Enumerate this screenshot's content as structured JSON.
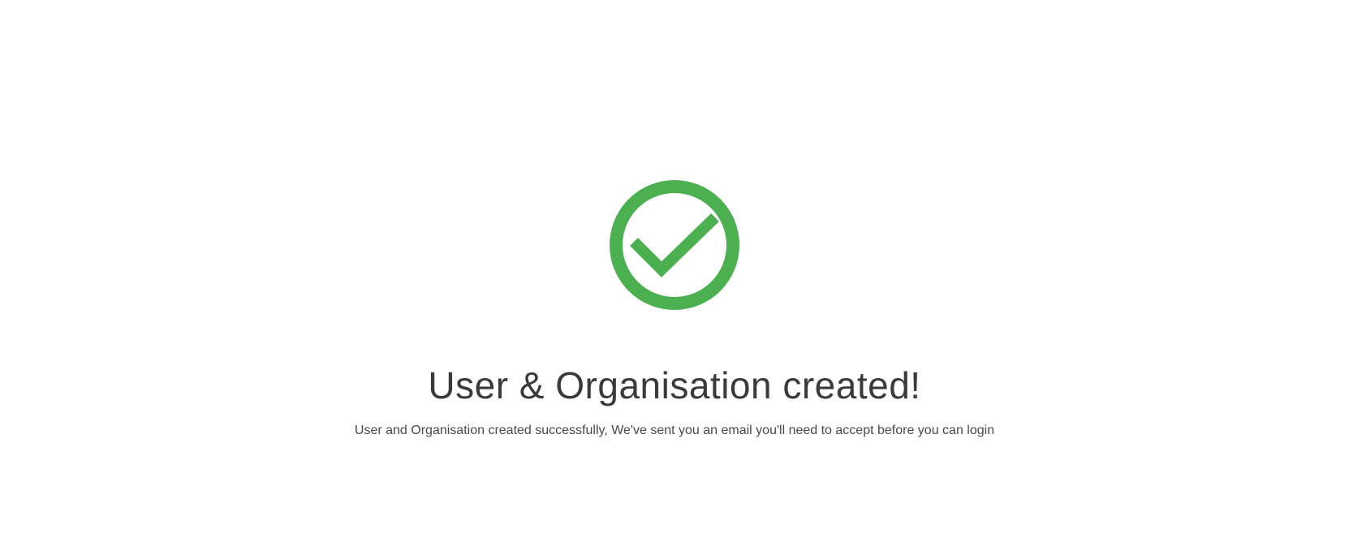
{
  "confirmation": {
    "icon": "check-circle-icon",
    "icon_color": "#4caf50",
    "title": "User & Organisation created!",
    "message": "User and Organisation created successfully, We've sent you an email you'll need to accept before you can login"
  }
}
